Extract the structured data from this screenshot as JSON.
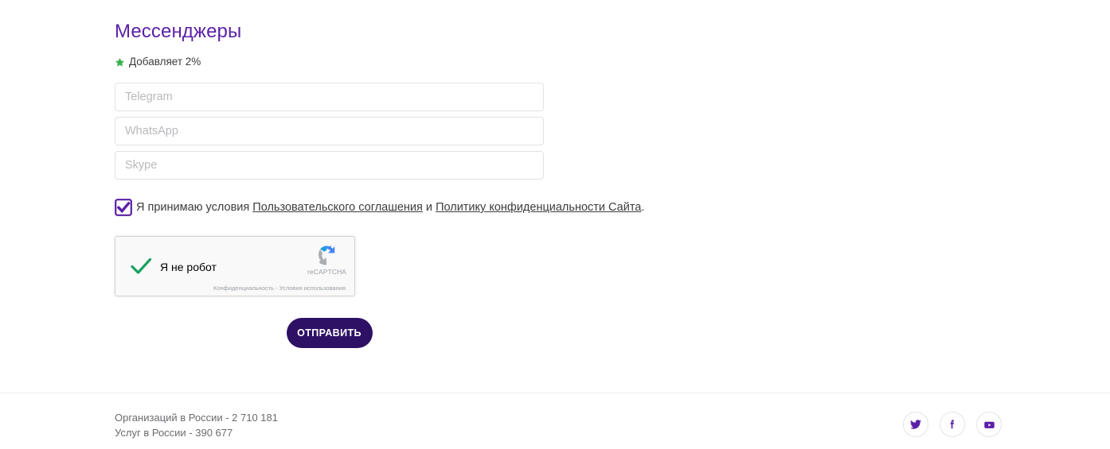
{
  "theme": {
    "accent_purple": "#5b1fa8",
    "button_purple": "#2e1065",
    "star_green": "#37b24d",
    "check_green": "#1aa260",
    "border_gray": "#e2e2e5",
    "text_gray": "#3c3c3c",
    "placeholder_gray": "#b9b9bd"
  },
  "form": {
    "title": "Мессенджеры",
    "bonus_text": "Добавляет 2%",
    "star_icon": "star-icon",
    "fields": [
      {
        "name": "telegram",
        "placeholder": "Telegram",
        "value": ""
      },
      {
        "name": "whatsapp",
        "placeholder": "WhatsApp",
        "value": ""
      },
      {
        "name": "skype",
        "placeholder": "Skype",
        "value": ""
      }
    ],
    "agreement": {
      "checkbox_checked": true,
      "prefix": "Я принимаю условия ",
      "link1": "Пользовательского соглашения",
      "conjunction": " и ",
      "link2": "Политику конфиденциальности Сайта",
      "suffix": "."
    },
    "recaptcha": {
      "label": "Я не робот",
      "brand": "reCAPTCHA",
      "privacy": "Конфиденциальность",
      "separator": " - ",
      "terms": "Условия использования",
      "checked": true
    },
    "submit_label": "ОТПРАВИТЬ"
  },
  "footer": {
    "stats": [
      "Организаций в России - 2 710 181",
      "Услуг в России - 390 677"
    ],
    "socials": [
      {
        "name": "twitter",
        "icon": "twitter-icon"
      },
      {
        "name": "facebook",
        "icon": "facebook-icon"
      },
      {
        "name": "youtube",
        "icon": "youtube-icon"
      }
    ]
  }
}
